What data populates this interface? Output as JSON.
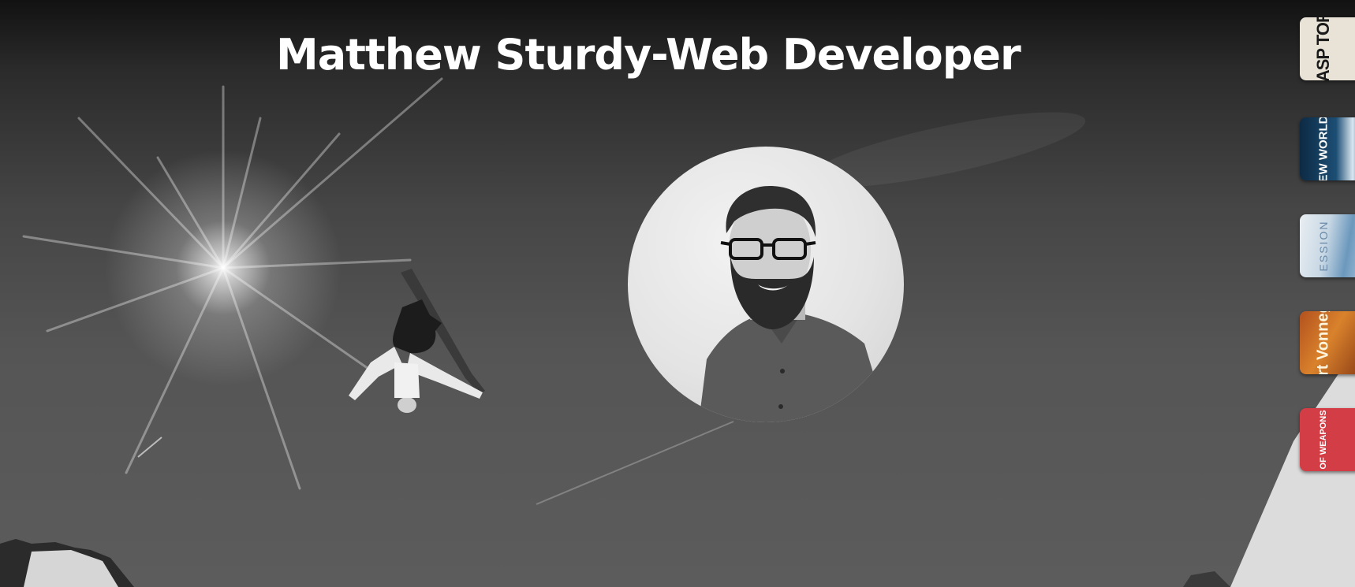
{
  "header": {
    "title": "Matthew Sturdy-Web Developer"
  },
  "profile": {
    "portrait_icon": "person-with-glasses-portrait"
  },
  "background": {
    "scene": "snowboarder-silhouette-with-sun"
  },
  "carousel": {
    "items": [
      {
        "label": "WASP TORY",
        "icon": "book-cover"
      },
      {
        "label": "EW WORLD",
        "icon": "book-cover"
      },
      {
        "label": "ESSION",
        "icon": "book-cover"
      },
      {
        "label": "Kurt Vonnegut",
        "icon": "book-cover"
      },
      {
        "label": "OF WEAPONS",
        "icon": "book-cover"
      }
    ]
  },
  "colors": {
    "title": "#ffffff",
    "background_dark": "#121212",
    "background_mid": "#555555",
    "thumb_red": "#d33d45",
    "thumb_navy": "#0d2a44",
    "thumb_orange": "#d9822c"
  }
}
